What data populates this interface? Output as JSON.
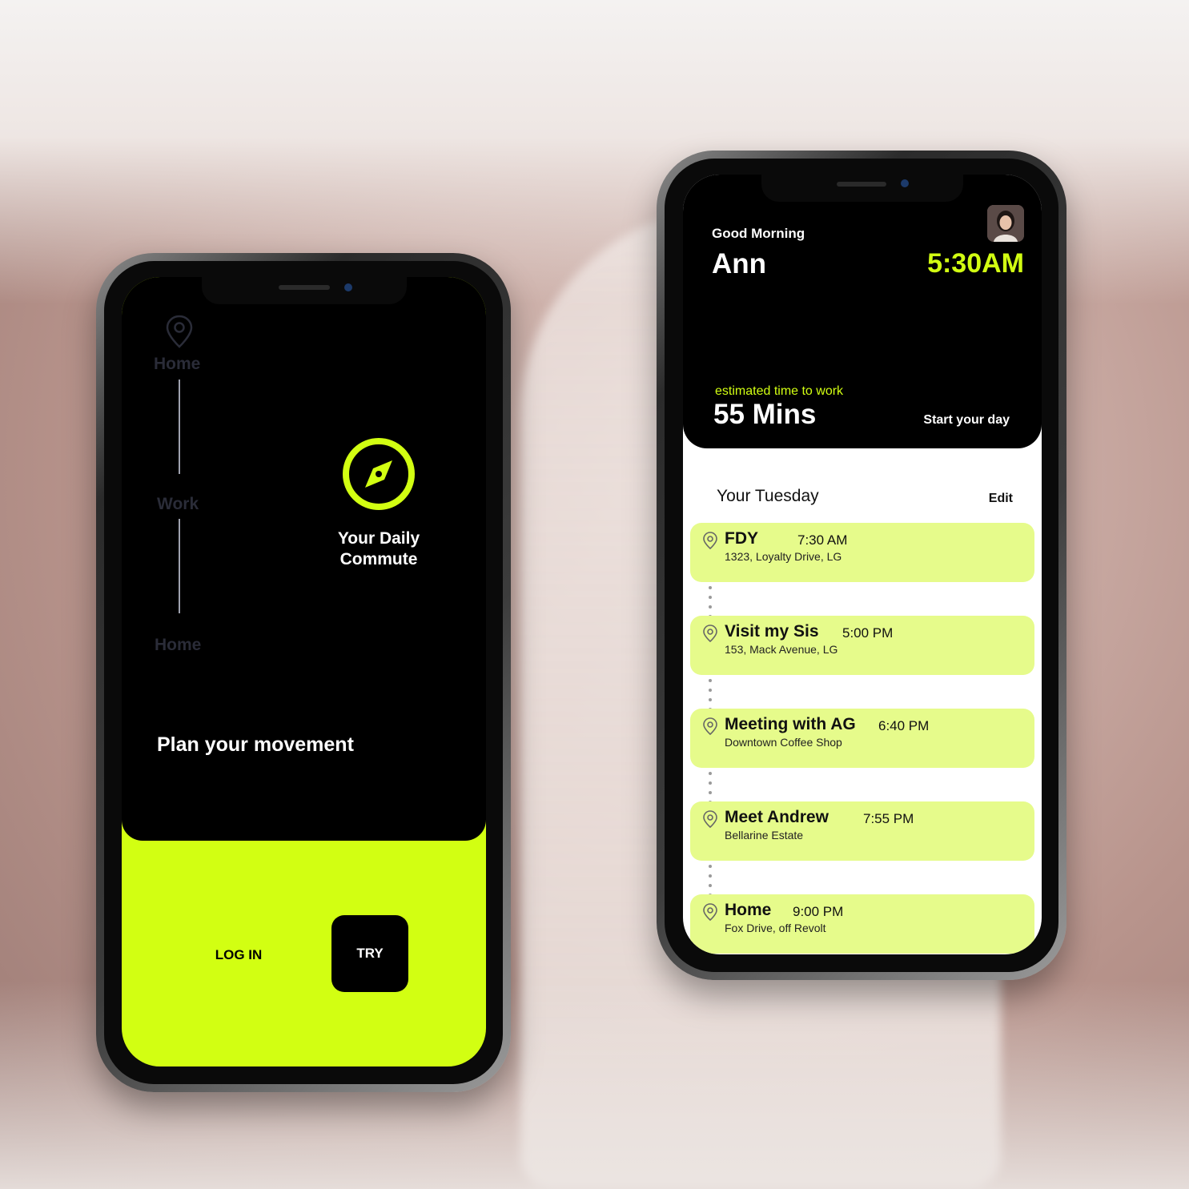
{
  "left_phone": {
    "route": {
      "start_label": "Home",
      "middle_label": "Work",
      "end_label": "Home"
    },
    "feature_title_line1": "Your Daily",
    "feature_title_line2": "Commute",
    "tagline": "Plan your movement",
    "login_label": "LOG IN",
    "try_label": "TRY",
    "accent_color": "#d2ff12"
  },
  "right_phone": {
    "greeting": "Good Morning",
    "user_name": "Ann",
    "current_time": "5:30AM",
    "estimate_label": "estimated time to work",
    "estimate_value": "55 Mins",
    "start_label": "Start your day",
    "section_title": "Your Tuesday",
    "edit_label": "Edit",
    "events": [
      {
        "title": "FDY",
        "time": "7:30 AM",
        "address": "1323, Loyalty Drive, LG"
      },
      {
        "title": "Visit my Sis",
        "time": "5:00 PM",
        "address": "153, Mack Avenue, LG"
      },
      {
        "title": "Meeting with AG",
        "time": "6:40 PM",
        "address": "Downtown Coffee Shop"
      },
      {
        "title": "Meet Andrew",
        "time": "7:55 PM",
        "address": "Bellarine Estate"
      },
      {
        "title": "Home",
        "time": "9:00 PM",
        "address": "Fox Drive, off Revolt"
      }
    ],
    "card_color": "#e6fb8b"
  }
}
